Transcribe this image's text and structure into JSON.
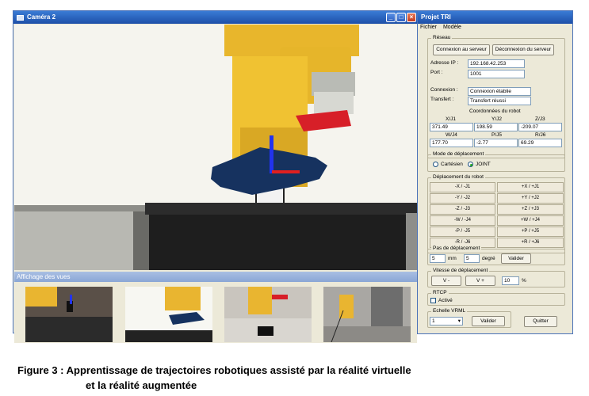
{
  "camera_window": {
    "title": "Caméra 2",
    "controls": {
      "minimize": "_",
      "maximize": "□",
      "close": "×"
    },
    "thumbnails_bar": "Affichage des vues"
  },
  "panel": {
    "title": "Projet TRI",
    "menu": [
      "Fichier",
      "Modèle"
    ],
    "reseau": {
      "title": "Réseau",
      "connect": "Connexion au serveur",
      "disconnect": "Déconnexion du serveur",
      "ip_label": "Adresse IP :",
      "ip_value": "192.168.42.253",
      "port_label": "Port :",
      "port_value": "1001",
      "conn_label": "Connexion :",
      "conn_value": "Connexion établie",
      "transfer_label": "Transfert :",
      "transfer_value": "Transfert réussi",
      "coords_title": "Coordonnées du robot",
      "c1": [
        "X/J1",
        "Y/J2",
        "Z/J3"
      ],
      "v1": [
        "371.49",
        "198.59",
        "-209.07"
      ],
      "c2": [
        "W/J4",
        "P/J5",
        "R/J6"
      ],
      "v2": [
        "177.70",
        "-2.77",
        "69.29"
      ]
    },
    "mode": {
      "title": "Mode de déplacement",
      "opt1": "Cartésien",
      "opt2": "JOINT",
      "selected": "JOINT"
    },
    "deplacement": {
      "title": "Déplacement du robot",
      "left": [
        "-X / -J1",
        "-Y / -J2",
        "-Z / -J3",
        "-W / -J4",
        "-P / -J5",
        "-R / -J6"
      ],
      "right": [
        "+X / +J1",
        "+Y / +J2",
        "+Z / +J3",
        "+W / +J4",
        "+P / +J5",
        "+R / +J6"
      ]
    },
    "pas": {
      "title": "Pas de déplacement",
      "mm_value": "5",
      "mm_unit": "mm",
      "deg_value": "5",
      "deg_unit": "degré",
      "validate": "Valider"
    },
    "vitesse": {
      "title": "Vitesse de déplacement",
      "minus": "V -",
      "plus": "V +",
      "value": "10",
      "unit": "%"
    },
    "rtcp": {
      "title": "RTCP",
      "active": "Activé"
    },
    "vrml": {
      "title": "Echelle VRML",
      "value": "1",
      "validate": "Valider"
    },
    "quit": "Quitter"
  },
  "caption": {
    "line1": "Figure 3 : Apprentissage de trajectoires robotiques assisté par la réalité virtuelle",
    "line2": "et la réalité augmentée"
  }
}
